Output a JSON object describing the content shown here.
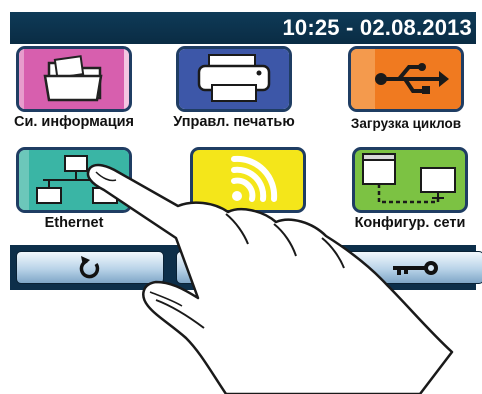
{
  "status_bar": {
    "datetime": "10:25 - 02.08.2013"
  },
  "tiles": [
    {
      "label": "Си. информация",
      "icon": "folder-icon",
      "color": "#d75fae"
    },
    {
      "label": "Управл. печатью",
      "icon": "printer-icon",
      "color": "#3d57a8"
    },
    {
      "label": "Загрузка циклов",
      "icon": "usb-icon",
      "color": "#f07a20"
    },
    {
      "label": "Ethernet",
      "icon": "network-icon",
      "color": "#3ab5a5"
    },
    {
      "label": "",
      "icon": "wifi-icon",
      "color": "#f4e61a"
    },
    {
      "label": "Конфигур. сети",
      "icon": "network-config-icon",
      "color": "#7cc243"
    }
  ],
  "nav_buttons": [
    {
      "icon": "refresh-icon"
    },
    {
      "icon": "home-icon"
    },
    {
      "icon": "key-icon"
    }
  ],
  "overlay": {
    "icon": "pointing-hand-icon"
  }
}
